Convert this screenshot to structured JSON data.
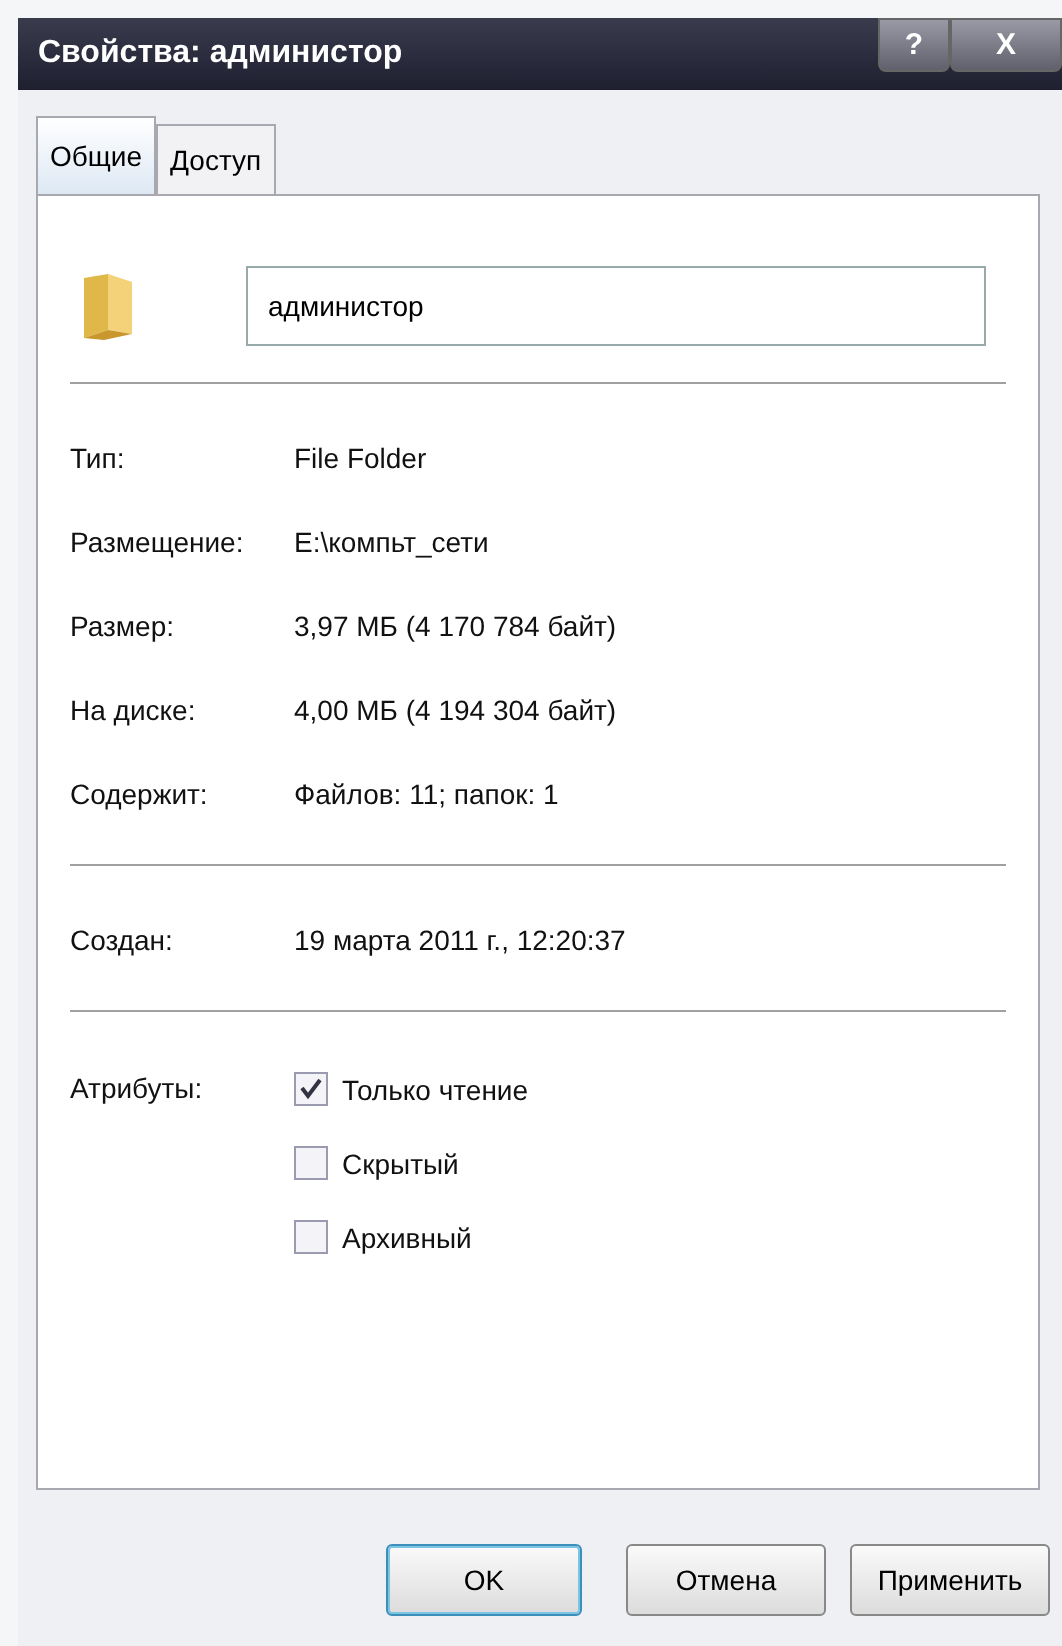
{
  "window": {
    "title": "Свойства: администор",
    "help": "?",
    "close": "X"
  },
  "tabs": [
    {
      "label": "Общие",
      "selected": true
    },
    {
      "label": "Доступ",
      "selected": false
    }
  ],
  "name_field": {
    "value": "администор"
  },
  "groups": [
    [
      {
        "label": "Тип:",
        "value": "File Folder"
      },
      {
        "label": "Размещение:",
        "value": "E:\\компьт_сети"
      },
      {
        "label": "Размер:",
        "value": "3,97 МБ (4 170 784 байт)"
      },
      {
        "label": "На диске:",
        "value": "4,00 МБ (4 194 304 байт)"
      },
      {
        "label": "Содержит:",
        "value": "Файлов: 11; папок: 1"
      }
    ],
    [
      {
        "label": "Создан:",
        "value": "19 марта 2011 г., 12:20:37"
      }
    ]
  ],
  "attributes": {
    "label": "Атрибуты:",
    "items": [
      {
        "label": "Только чтение",
        "checked": true
      },
      {
        "label": "Скрытый",
        "checked": false
      },
      {
        "label": "Архивный",
        "checked": false
      }
    ]
  },
  "buttons": [
    {
      "label": "OK",
      "default": true
    },
    {
      "label": "Отмена",
      "default": false
    },
    {
      "label": "Применить",
      "default": false
    }
  ]
}
